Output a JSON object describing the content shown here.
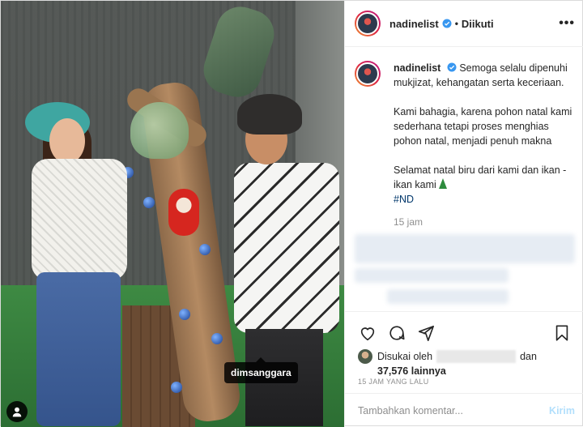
{
  "post": {
    "photo_tag": "dimsanggara"
  },
  "header": {
    "username": "nadinelist",
    "separator": "•",
    "follow_status": "Diikuti",
    "more_label": "•••"
  },
  "caption": {
    "username": "nadinelist",
    "line1": "Semoga selalu dipenuhi mukjizat, kehangatan serta keceriaan.",
    "line2": "Kami bahagia, karena pohon natal kami sederhana tetapi proses menghias pohon natal, menjadi penuh makna",
    "line3": "Selamat natal biru dari kami dan ikan - ikan kami",
    "hashtag": "#ND",
    "time": "15 jam"
  },
  "likes": {
    "prefix": "Disukai oleh",
    "and": "dan",
    "count": "37,576",
    "suffix": "lainnya"
  },
  "posted_ago": "15 JAM YANG LALU",
  "comment_box": {
    "placeholder": "Tambahkan komentar...",
    "post_label": "Kirim"
  },
  "icons": {
    "like": "heart-icon",
    "comment": "comment-icon",
    "share": "share-icon",
    "save": "bookmark-icon",
    "verified": "verified-badge-icon",
    "user_tag": "user-tag-icon",
    "tree_emoji": "christmas-tree-emoji"
  },
  "colors": {
    "verified": "#3897f0",
    "link": "#00376b",
    "muted": "#8e8e8e",
    "post_disabled": "#b2dffc"
  }
}
